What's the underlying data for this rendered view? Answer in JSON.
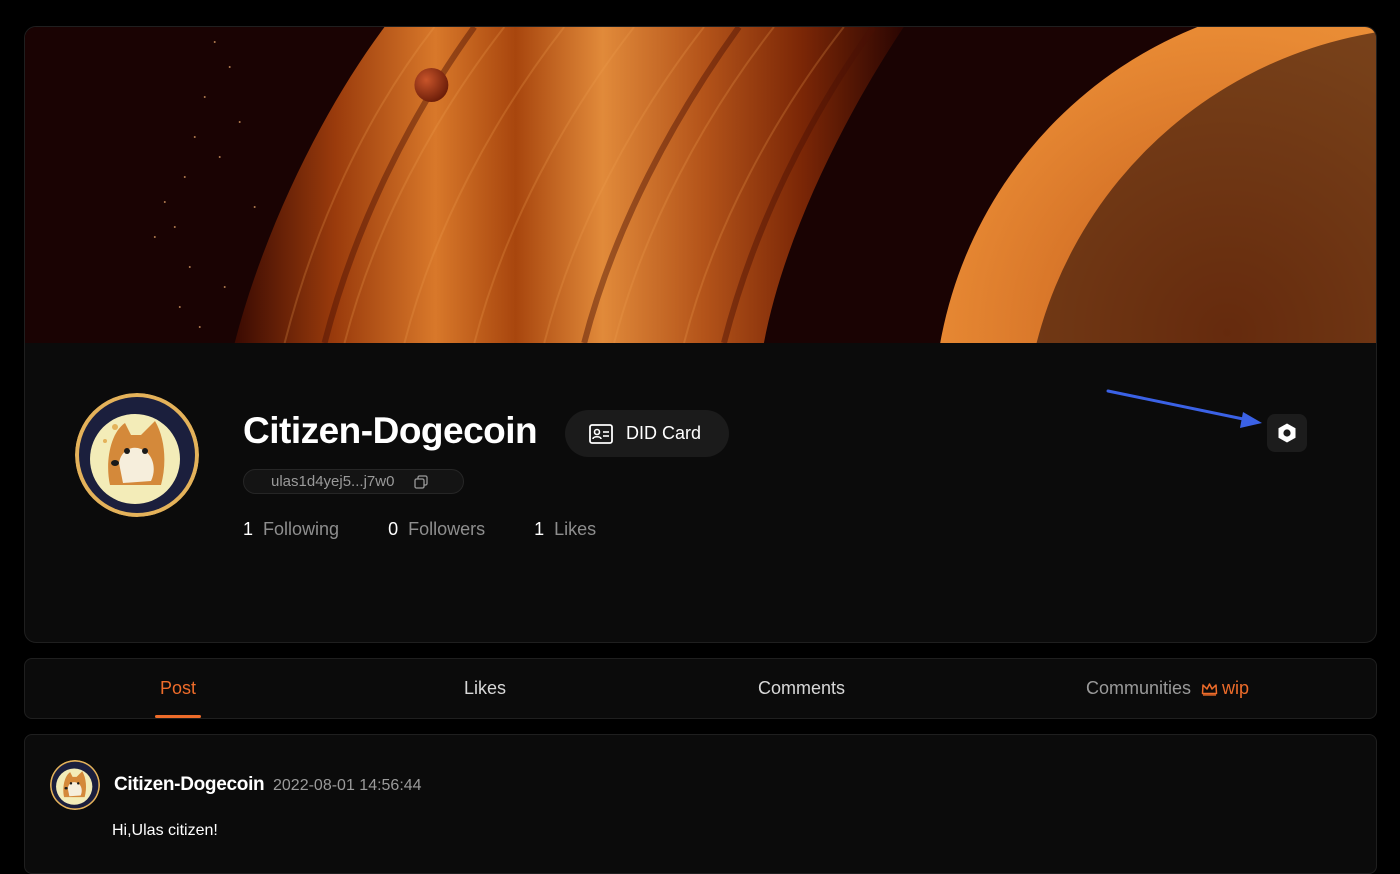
{
  "profile": {
    "username": "Citizen-Dogecoin",
    "did_card_label": "DID Card",
    "address": "ulas1d4yej5...j7w0",
    "stats": [
      {
        "value": "1",
        "label": "Following"
      },
      {
        "value": "0",
        "label": "Followers"
      },
      {
        "value": "1",
        "label": "Likes"
      }
    ]
  },
  "tabs": [
    {
      "label": "Post",
      "active": true
    },
    {
      "label": "Likes",
      "active": false
    },
    {
      "label": "Comments",
      "active": false
    },
    {
      "label": "Communities",
      "active": false,
      "badge": "wip"
    }
  ],
  "post": {
    "author": "Citizen-Dogecoin",
    "timestamp": "2022-08-01 14:56:44",
    "text": "Hi,Ulas citizen!"
  },
  "icons": {
    "did_card": "id-card-icon",
    "copy": "copy-icon",
    "settings": "hexagon-settings-icon",
    "wip": "crown-icon",
    "annotation": "blue-arrow"
  },
  "colors": {
    "accent": "#ee6c2a",
    "background": "#000000",
    "card": "#0b0b0b",
    "annotation_arrow": "#3b62e6"
  }
}
